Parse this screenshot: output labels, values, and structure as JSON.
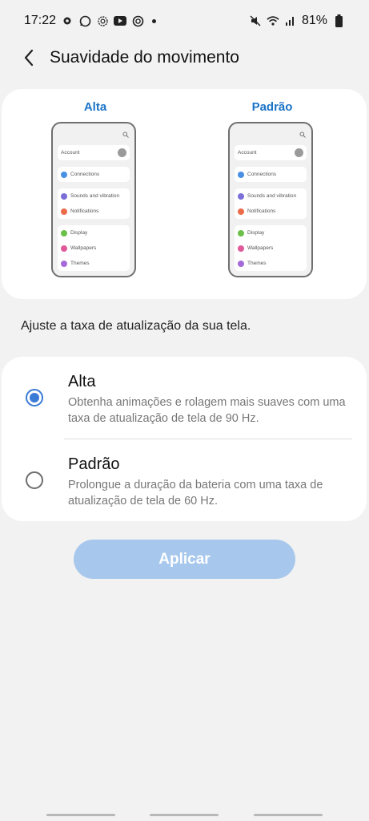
{
  "status_bar": {
    "time": "17:22",
    "battery": "81%",
    "left_icons": [
      "settings-gear-icon",
      "whatsapp-icon",
      "sun-icon",
      "youtube-icon",
      "app-icon",
      "dot-icon"
    ],
    "right_icons": [
      "mute-icon",
      "wifi-icon",
      "signal-icon",
      "battery-icon"
    ]
  },
  "header": {
    "title": "Suavidade do movimento"
  },
  "preview": {
    "left_label": "Alta",
    "right_label": "Padrão",
    "phone_items": {
      "account": "Account",
      "connections": "Connections",
      "sounds": "Sounds and vibration",
      "notifications": "Notifications",
      "display": "Display",
      "wallpapers": "Wallpapers",
      "themes": "Themes"
    }
  },
  "subtitle": "Ajuste a taxa de atualização da sua tela.",
  "options": [
    {
      "title": "Alta",
      "description": "Obtenha animações e rolagem mais suaves com uma taxa de atualização de tela de 90 Hz.",
      "selected": true
    },
    {
      "title": "Padrão",
      "description": "Prolongue a duração da bateria com uma taxa de atualização de tela de 60 Hz.",
      "selected": false
    }
  ],
  "apply_button": {
    "label": "Aplicar",
    "enabled": false
  },
  "colors": {
    "accent": "#1a73c7",
    "radio": "#3a7bd5",
    "button_disabled": "#a7c8ec",
    "background": "#f2f2f2"
  }
}
